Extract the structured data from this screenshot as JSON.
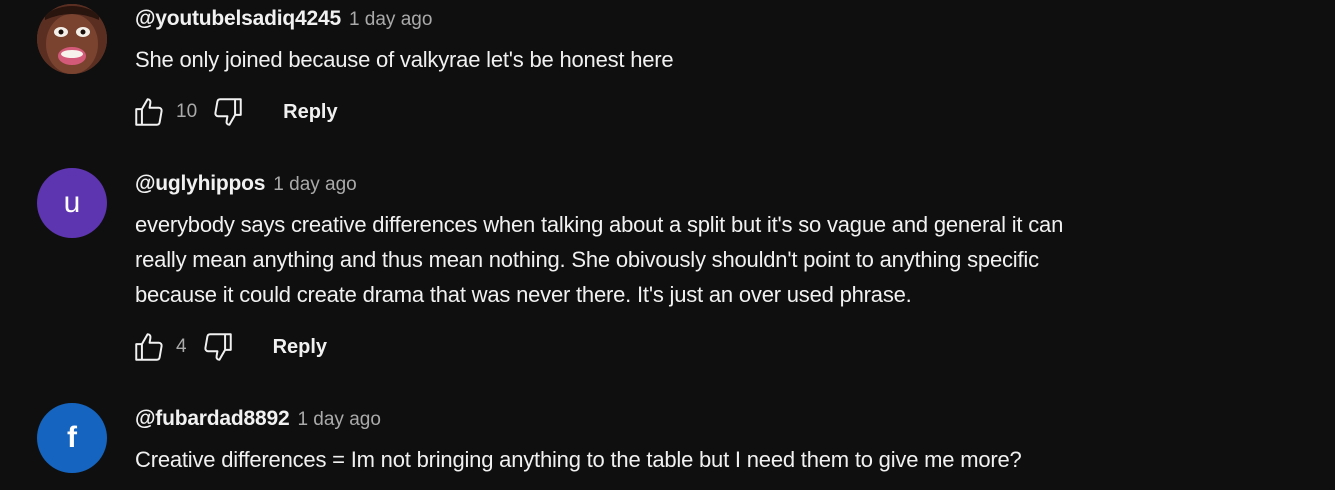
{
  "comments": [
    {
      "author": "@youtubelsadiq4245",
      "time": "1 day ago",
      "lines": [
        "She only joined because of valkyrae let's be honest here"
      ],
      "likes": "10",
      "reply_label": "Reply",
      "avatar": {
        "type": "photo",
        "bg": "#6b3a2a"
      }
    },
    {
      "author": "@uglyhippos",
      "time": "1 day ago",
      "lines": [
        "everybody says creative differences when talking about a split but it's so vague and general it can",
        "really mean anything and thus mean nothing. She obivously shouldn't point to anything specific",
        "because it could create drama that was never there. It's just an over used phrase."
      ],
      "likes": "4",
      "reply_label": "Reply",
      "avatar": {
        "type": "letter",
        "letter": "u",
        "bg": "#5e35b1"
      }
    },
    {
      "author": "@fubardad8892",
      "time": "1 day ago",
      "lines": [
        "Creative differences = Im not bringing anything to the table but I need them to give me more?"
      ],
      "avatar": {
        "type": "letter",
        "letter": "f",
        "bg": "#1565c0"
      }
    }
  ],
  "icons": {
    "like": "thumbs-up-icon",
    "dislike": "thumbs-down-icon"
  }
}
